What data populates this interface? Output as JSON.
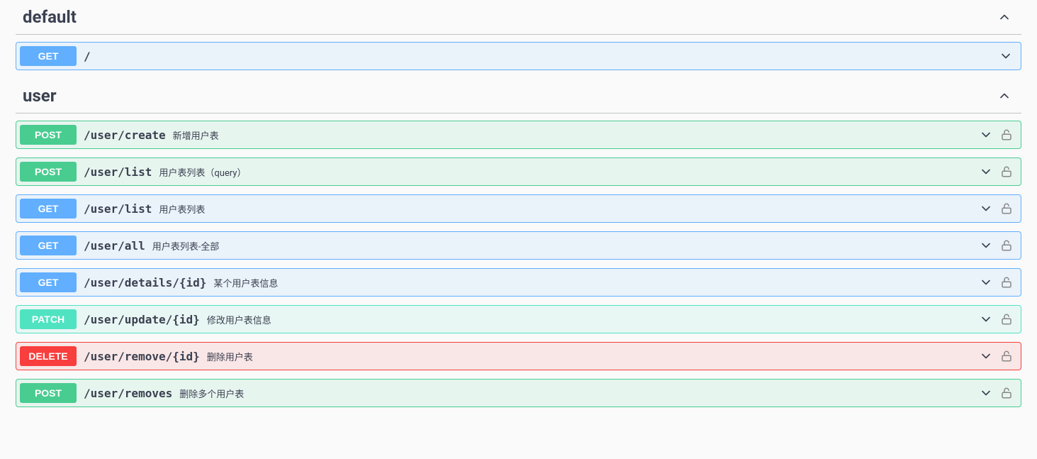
{
  "sections": [
    {
      "name": "default",
      "expanded": "up",
      "operations": [
        {
          "method": "GET",
          "path": "/",
          "summary": "",
          "lock": false
        }
      ]
    },
    {
      "name": "user",
      "expanded": "up",
      "operations": [
        {
          "method": "POST",
          "path": "/user/create",
          "summary": "新增用户表",
          "lock": true
        },
        {
          "method": "POST",
          "path": "/user/list",
          "summary": "用户表列表（query）",
          "lock": true
        },
        {
          "method": "GET",
          "path": "/user/list",
          "summary": "用户表列表",
          "lock": true
        },
        {
          "method": "GET",
          "path": "/user/all",
          "summary": "用户表列表-全部",
          "lock": true
        },
        {
          "method": "GET",
          "path": "/user/details/{id}",
          "summary": "某个用户表信息",
          "lock": true
        },
        {
          "method": "PATCH",
          "path": "/user/update/{id}",
          "summary": "修改用户表信息",
          "lock": true
        },
        {
          "method": "DELETE",
          "path": "/user/remove/{id}",
          "summary": "删除用户表",
          "lock": true
        },
        {
          "method": "POST",
          "path": "/user/removes",
          "summary": "删除多个用户表",
          "lock": true
        }
      ]
    }
  ]
}
